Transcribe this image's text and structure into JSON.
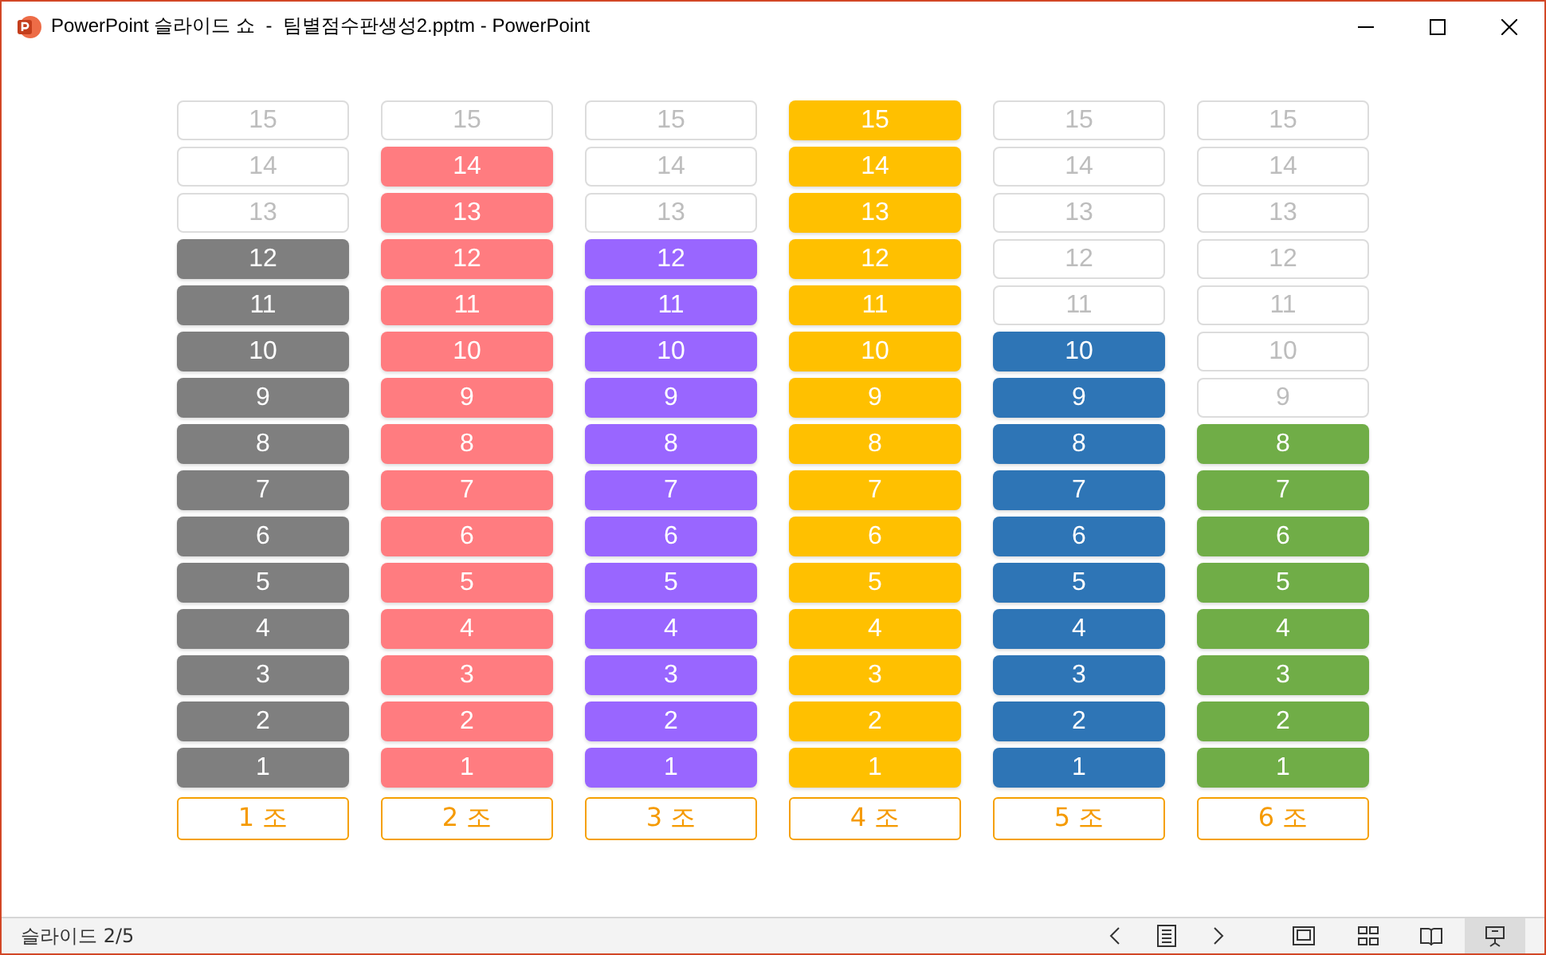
{
  "window": {
    "title": "PowerPoint 슬라이드 쇼  -  팀별점수판생성2.pptm - PowerPoint"
  },
  "teams": [
    {
      "label": "1 조",
      "color": "#7f7f7f",
      "cells": [
        {
          "label": "15",
          "filled": false
        },
        {
          "label": "14",
          "filled": false
        },
        {
          "label": "13",
          "filled": false
        },
        {
          "label": "12",
          "filled": true
        },
        {
          "label": "11",
          "filled": true
        },
        {
          "label": "10",
          "filled": true
        },
        {
          "label": "9",
          "filled": true
        },
        {
          "label": "8",
          "filled": true
        },
        {
          "label": "7",
          "filled": true
        },
        {
          "label": "6",
          "filled": true
        },
        {
          "label": "5",
          "filled": true
        },
        {
          "label": "4",
          "filled": true
        },
        {
          "label": "3",
          "filled": true
        },
        {
          "label": "2",
          "filled": true
        },
        {
          "label": "1",
          "filled": true
        }
      ]
    },
    {
      "label": "2 조",
      "color": "#ff7c80",
      "cells": [
        {
          "label": "15",
          "filled": false
        },
        {
          "label": "14",
          "filled": true
        },
        {
          "label": "13",
          "filled": true
        },
        {
          "label": "12",
          "filled": true
        },
        {
          "label": "11",
          "filled": true
        },
        {
          "label": "10",
          "filled": true
        },
        {
          "label": "9",
          "filled": true
        },
        {
          "label": "8",
          "filled": true
        },
        {
          "label": "7",
          "filled": true
        },
        {
          "label": "6",
          "filled": true
        },
        {
          "label": "5",
          "filled": true
        },
        {
          "label": "4",
          "filled": true
        },
        {
          "label": "3",
          "filled": true
        },
        {
          "label": "2",
          "filled": true
        },
        {
          "label": "1",
          "filled": true
        }
      ]
    },
    {
      "label": "3 조",
      "color": "#9966ff",
      "cells": [
        {
          "label": "15",
          "filled": false
        },
        {
          "label": "14",
          "filled": false
        },
        {
          "label": "13",
          "filled": false
        },
        {
          "label": "12",
          "filled": true
        },
        {
          "label": "11",
          "filled": true
        },
        {
          "label": "10",
          "filled": true
        },
        {
          "label": "9",
          "filled": true
        },
        {
          "label": "8",
          "filled": true
        },
        {
          "label": "7",
          "filled": true
        },
        {
          "label": "6",
          "filled": true
        },
        {
          "label": "5",
          "filled": true
        },
        {
          "label": "4",
          "filled": true
        },
        {
          "label": "3",
          "filled": true
        },
        {
          "label": "2",
          "filled": true
        },
        {
          "label": "1",
          "filled": true
        }
      ]
    },
    {
      "label": "4 조",
      "color": "#ffc000",
      "cells": [
        {
          "label": "15",
          "filled": true
        },
        {
          "label": "14",
          "filled": true
        },
        {
          "label": "13",
          "filled": true
        },
        {
          "label": "12",
          "filled": true
        },
        {
          "label": "11",
          "filled": true
        },
        {
          "label": "10",
          "filled": true
        },
        {
          "label": "9",
          "filled": true
        },
        {
          "label": "8",
          "filled": true
        },
        {
          "label": "7",
          "filled": true
        },
        {
          "label": "6",
          "filled": true
        },
        {
          "label": "5",
          "filled": true
        },
        {
          "label": "4",
          "filled": true
        },
        {
          "label": "3",
          "filled": true
        },
        {
          "label": "2",
          "filled": true
        },
        {
          "label": "1",
          "filled": true
        }
      ]
    },
    {
      "label": "5 조",
      "color": "#2e75b6",
      "cells": [
        {
          "label": "15",
          "filled": false
        },
        {
          "label": "14",
          "filled": false
        },
        {
          "label": "13",
          "filled": false
        },
        {
          "label": "12",
          "filled": false
        },
        {
          "label": "11",
          "filled": false
        },
        {
          "label": "10",
          "filled": true
        },
        {
          "label": "9",
          "filled": true
        },
        {
          "label": "8",
          "filled": true
        },
        {
          "label": "7",
          "filled": true
        },
        {
          "label": "6",
          "filled": true
        },
        {
          "label": "5",
          "filled": true
        },
        {
          "label": "4",
          "filled": true
        },
        {
          "label": "3",
          "filled": true
        },
        {
          "label": "2",
          "filled": true
        },
        {
          "label": "1",
          "filled": true
        }
      ]
    },
    {
      "label": "6 조",
      "color": "#70ad47",
      "cells": [
        {
          "label": "15",
          "filled": false
        },
        {
          "label": "14",
          "filled": false
        },
        {
          "label": "13",
          "filled": false
        },
        {
          "label": "12",
          "filled": false
        },
        {
          "label": "11",
          "filled": false
        },
        {
          "label": "10",
          "filled": false
        },
        {
          "label": "9",
          "filled": false
        },
        {
          "label": "8",
          "filled": true
        },
        {
          "label": "7",
          "filled": true
        },
        {
          "label": "6",
          "filled": true
        },
        {
          "label": "5",
          "filled": true
        },
        {
          "label": "4",
          "filled": true
        },
        {
          "label": "3",
          "filled": true
        },
        {
          "label": "2",
          "filled": true
        },
        {
          "label": "1",
          "filled": true
        }
      ]
    }
  ],
  "status_bar": {
    "slide": "슬라이드 2/5",
    "views": [
      {
        "kind": "normal",
        "selected": false
      },
      {
        "kind": "sorter",
        "selected": false
      },
      {
        "kind": "reading",
        "selected": false
      },
      {
        "kind": "slideshow",
        "selected": true
      }
    ]
  }
}
